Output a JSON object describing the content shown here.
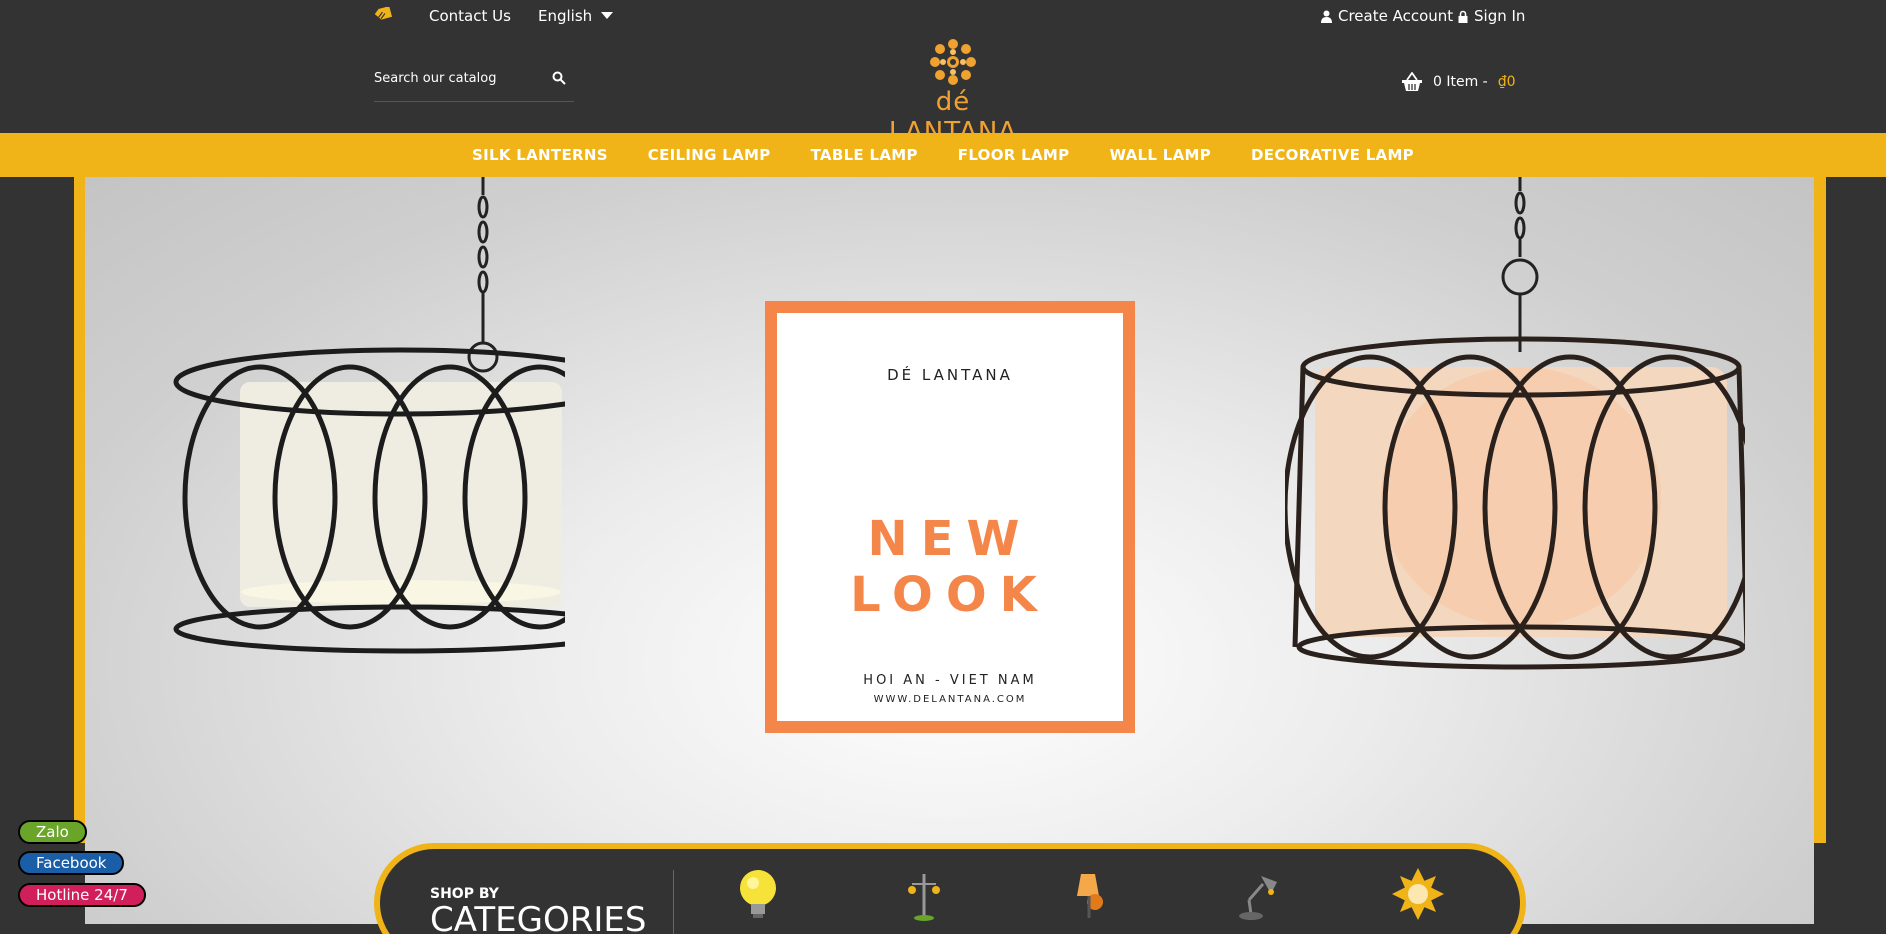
{
  "topbar": {
    "contact_label": "Contact Us",
    "language_label": "English",
    "create_account_label": "Create Account",
    "sign_in_label": "Sign In"
  },
  "header": {
    "search_placeholder": "Search our catalog",
    "logo_text": "dé LANTANA",
    "cart_count_label": "0 Item -",
    "cart_total": "₫0"
  },
  "nav": {
    "items": [
      {
        "label": "SILK LANTERNS"
      },
      {
        "label": "CEILING LAMP"
      },
      {
        "label": "TABLE LAMP"
      },
      {
        "label": "FLOOR LAMP"
      },
      {
        "label": "WALL LAMP"
      },
      {
        "label": "DECORATIVE LAMP"
      }
    ]
  },
  "banner": {
    "brand": "DÉ LANTANA",
    "headline": "NEW LOOK",
    "location": "HOI AN - VIET NAM",
    "url": "WWW.DELANTANA.COM"
  },
  "categories": {
    "small_label": "SHOP BY",
    "big_label": "CATEGORIES",
    "icons": [
      "light-bulb-icon",
      "street-lamp-icon",
      "wall-sconce-icon",
      "desk-lamp-icon",
      "sun-lamp-icon"
    ]
  },
  "social": {
    "zalo": "Zalo",
    "facebook": "Facebook",
    "hotline": "Hotline 24/7"
  },
  "colors": {
    "background": "#333333",
    "accent": "#f0b418",
    "headline_orange": "#f5864a",
    "zalo": "#6aa52a",
    "facebook": "#1a5ea8",
    "hotline": "#d11f5c"
  }
}
